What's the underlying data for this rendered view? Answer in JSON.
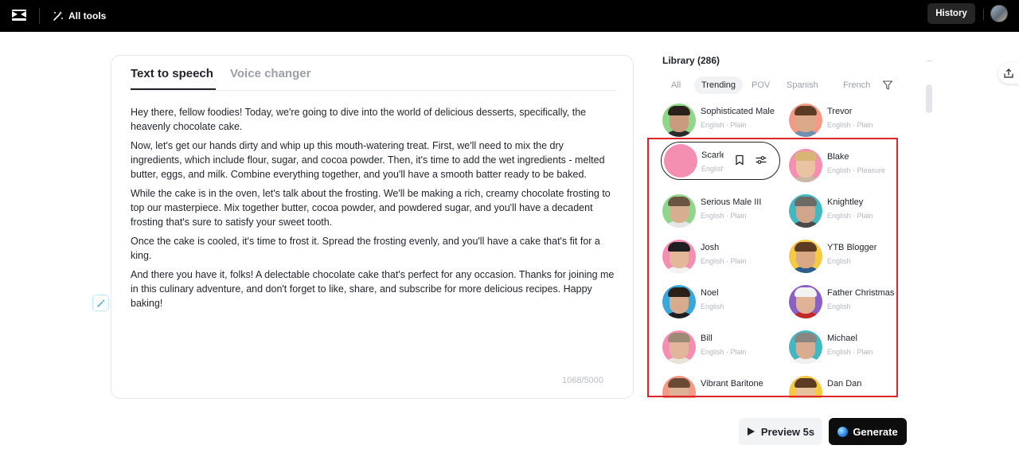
{
  "topbar": {
    "app_logo_icon": "capcut-logo-icon",
    "all_tools_label": "All tools",
    "history_label": "History",
    "avatar_icon": "user-avatar-icon"
  },
  "editor": {
    "tabs": [
      {
        "label": "Text to speech",
        "active": true
      },
      {
        "label": "Voice changer",
        "active": false
      }
    ],
    "paragraphs": [
      "Hey there, fellow foodies! Today, we're going to dive into the world of delicious desserts, specifically, the heavenly chocolate cake.",
      "Now, let's get our hands dirty and whip up this mouth-watering treat. First, we'll need to mix the dry ingredients, which include flour, sugar, and cocoa powder. Then, it's time to add the wet ingredients - melted butter, eggs, and milk. Combine everything together, and you'll have a smooth batter ready to be baked.",
      "While the cake is in the oven, let's talk about the frosting. We'll be making a rich, creamy chocolate frosting to top our masterpiece. Mix together butter, cocoa powder, and powdered sugar, and you'll have a decadent frosting that's sure to satisfy your sweet tooth.",
      "Once the cake is cooled, it's time to frost it. Spread the frosting evenly, and you'll have a cake that's fit for a king.",
      "And there you have it, folks! A delectable chocolate cake that's perfect for any occasion. Thanks for joining me in this culinary adventure, and don't forget to like, share, and subscribe for more delicious recipes. Happy baking!"
    ],
    "char_count": "1068/5000"
  },
  "library": {
    "title": "Library (286)",
    "filters": [
      "All",
      "Trending",
      "POV",
      "Spanish",
      "French"
    ],
    "selected_filter": "Trending",
    "voices": [
      {
        "name": "Sophisticated Male",
        "sub": "English · Plain",
        "bg": "#8fd68a",
        "skin": "#c99a7c",
        "hair": "#2a211c",
        "shirt": "#2b2b2e"
      },
      {
        "name": "Trevor",
        "sub": "English · Plain",
        "bg": "#f29a86",
        "skin": "#d9a98a",
        "hair": "#5a3a24",
        "shirt": "#6f8fb0"
      },
      {
        "name": "Scarlett",
        "sub": "English",
        "bg": "#f48fb1",
        "skin": "#e5b896",
        "hair": "#b86b3a",
        "shirt": "#e7d3c2"
      },
      {
        "name": "Blake",
        "sub": "English · Pleasure",
        "bg": "#f48fb1",
        "skin": "#eac3a3",
        "hair": "#d8b475",
        "shirt": "#c9b8a4"
      },
      {
        "name": "Serious Male III",
        "sub": "English · Plain",
        "bg": "#8fd68a",
        "skin": "#d8ae91",
        "hair": "#6b5442",
        "shirt": "#e6e6e6"
      },
      {
        "name": "Knightley",
        "sub": "English · Plain",
        "bg": "#43b7c2",
        "skin": "#cfa68c",
        "hair": "#6e6a66",
        "shirt": "#4a4a4a"
      },
      {
        "name": "Josh",
        "sub": "English · Plain",
        "bg": "#f48fb1",
        "skin": "#e2b898",
        "hair": "#1f1f22",
        "shirt": "#f2f2f2"
      },
      {
        "name": "YTB Blogger",
        "sub": "English",
        "bg": "#f6c945",
        "skin": "#d9a985",
        "hair": "#5b3b22",
        "shirt": "#2d5d8c"
      },
      {
        "name": "Noel",
        "sub": "English",
        "bg": "#3aa7d8",
        "skin": "#d7ac8e",
        "hair": "#2b211b",
        "shirt": "#1e1e22"
      },
      {
        "name": "Father Christmas",
        "sub": "English",
        "bg": "#8b5fc4",
        "skin": "#e0b296",
        "hair": "#f2f2f2",
        "shirt": "#c22a2a"
      },
      {
        "name": "Bill",
        "sub": "English · Plain",
        "bg": "#f48fb1",
        "skin": "#e1b69b",
        "hair": "#9c8a74",
        "shirt": "#e9e2d8"
      },
      {
        "name": "Michael",
        "sub": "English · Plain",
        "bg": "#43b7c2",
        "skin": "#d9ac92",
        "hair": "#8a8580",
        "shirt": "#f0f0f0"
      },
      {
        "name": "Vibrant Baritone",
        "sub": "",
        "bg": "#f29a86",
        "skin": "#deb196",
        "hair": "#6a4a34",
        "shirt": "#e8e8e8"
      },
      {
        "name": "Dan Dan",
        "sub": "",
        "bg": "#f6c945",
        "skin": "#e8c29d",
        "hair": "#5b3b22",
        "shirt": "#f2f2f2"
      }
    ],
    "hover_actions": [
      "bookmark-icon",
      "sliders-icon"
    ]
  },
  "actions": {
    "preview_label": "Preview 5s",
    "generate_label": "Generate"
  },
  "colors": {
    "topbar_bg": "#000000",
    "highlight": "#e0242e",
    "generate_bg": "#0d0d0d"
  }
}
